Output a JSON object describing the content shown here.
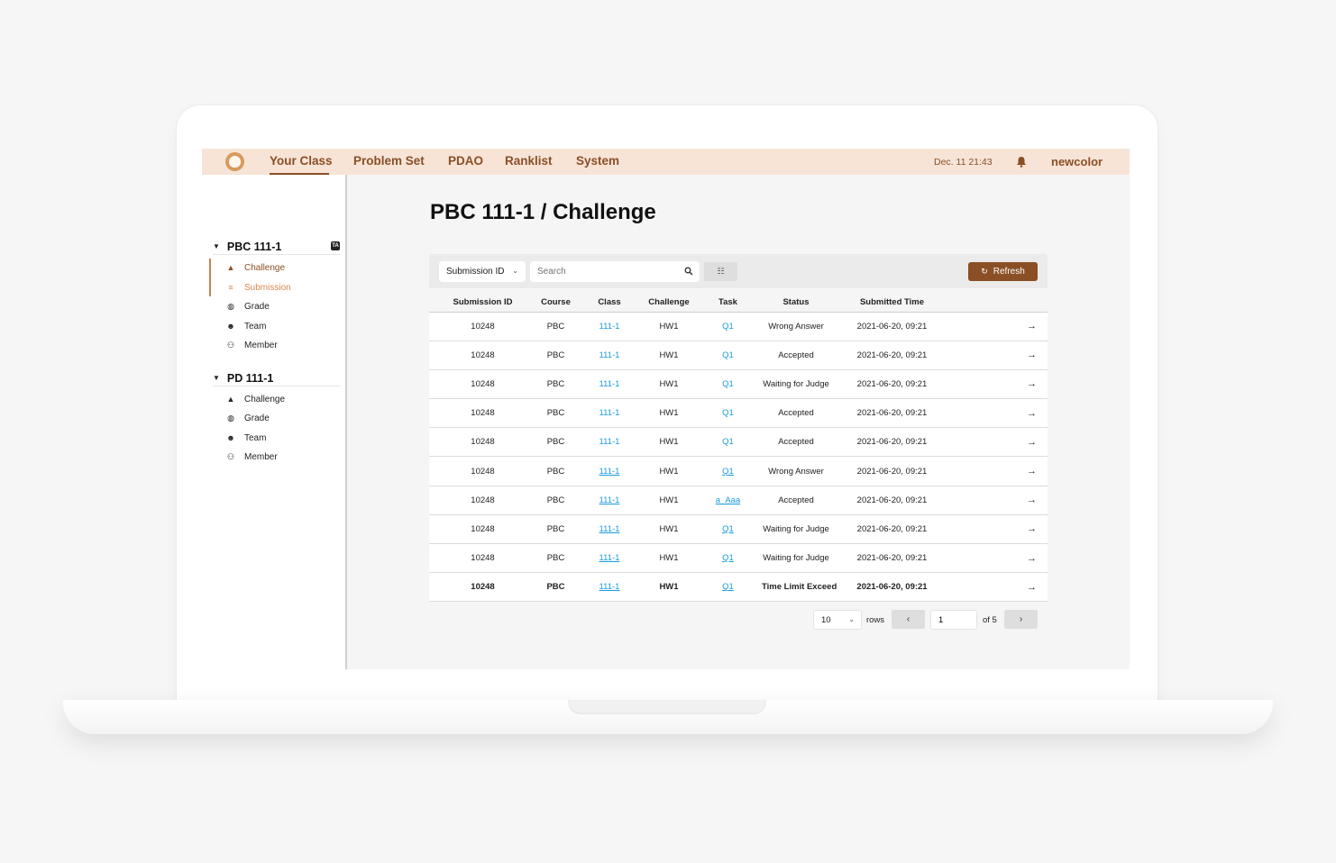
{
  "nav": {
    "items": [
      "Your Class",
      "Problem Set",
      "PDAO",
      "Ranklist",
      "System"
    ],
    "date": "Dec. 11  21:43",
    "user": "newcolor"
  },
  "sidebar": {
    "sections": [
      {
        "title": "PBC 111-1",
        "badge": "TA",
        "items": [
          {
            "label": "Challenge",
            "icon": "shapes-icon"
          },
          {
            "label": "Submission",
            "icon": "list-icon"
          },
          {
            "label": "Grade",
            "icon": "globe-icon"
          },
          {
            "label": "Team",
            "icon": "face-icon"
          },
          {
            "label": "Member",
            "icon": "people-icon"
          }
        ]
      },
      {
        "title": "PD 111-1",
        "items": [
          {
            "label": "Challenge",
            "icon": "shapes-icon"
          },
          {
            "label": "Grade",
            "icon": "globe-icon"
          },
          {
            "label": "Team",
            "icon": "face-icon"
          },
          {
            "label": "Member",
            "icon": "people-icon"
          }
        ]
      }
    ]
  },
  "main": {
    "title": "PBC 111-1 / Challenge",
    "filter_select": "Submission ID",
    "search_placeholder": "Search",
    "refresh_label": "Refresh"
  },
  "table": {
    "headers": [
      "Submission ID",
      "Course",
      "Class",
      "Challenge",
      "Task",
      "Status",
      "Submitted Time"
    ],
    "rows": [
      {
        "id": "10248",
        "course": "PBC",
        "class": "111-1",
        "challenge": "HW1",
        "task": "Q1",
        "status": "Wrong Answer",
        "time": "2021-06-20, 09:21"
      },
      {
        "id": "10248",
        "course": "PBC",
        "class": "111-1",
        "challenge": "HW1",
        "task": "Q1",
        "status": "Accepted",
        "time": "2021-06-20, 09:21"
      },
      {
        "id": "10248",
        "course": "PBC",
        "class": "111-1",
        "challenge": "HW1",
        "task": "Q1",
        "status": "Waiting for Judge",
        "time": "2021-06-20, 09:21"
      },
      {
        "id": "10248",
        "course": "PBC",
        "class": "111-1",
        "challenge": "HW1",
        "task": "Q1",
        "status": "Accepted",
        "time": "2021-06-20, 09:21"
      },
      {
        "id": "10248",
        "course": "PBC",
        "class": "111-1",
        "challenge": "HW1",
        "task": "Q1",
        "status": "Accepted",
        "time": "2021-06-20, 09:21"
      },
      {
        "id": "10248",
        "course": "PBC",
        "class": "111-1",
        "challenge": "HW1",
        "task": "Q1",
        "status": "Wrong Answer",
        "time": "2021-06-20, 09:21"
      },
      {
        "id": "10248",
        "course": "PBC",
        "class": "111-1",
        "challenge": "HW1",
        "task": "a_Aaa",
        "status": "Accepted",
        "time": "2021-06-20, 09:21"
      },
      {
        "id": "10248",
        "course": "PBC",
        "class": "111-1",
        "challenge": "HW1",
        "task": "Q1",
        "status": "Waiting for Judge",
        "time": "2021-06-20, 09:21"
      },
      {
        "id": "10248",
        "course": "PBC",
        "class": "111-1",
        "challenge": "HW1",
        "task": "Q1",
        "status": "Waiting for Judge",
        "time": "2021-06-20, 09:21"
      },
      {
        "id": "10248",
        "course": "PBC",
        "class": "111-1",
        "challenge": "HW1",
        "task": "Q1",
        "status": "Time Limit Exceed",
        "time": "2021-06-20, 09:21"
      }
    ]
  },
  "pagination": {
    "rows_per_page": "10",
    "rows_label": "rows",
    "page": "1",
    "of_label": "of 5"
  },
  "colors": {
    "brand": "#8a4f25",
    "topbar": "#f7e4d7",
    "link": "#1a9be0",
    "error": "#e22424",
    "success": "#2e9a36"
  }
}
